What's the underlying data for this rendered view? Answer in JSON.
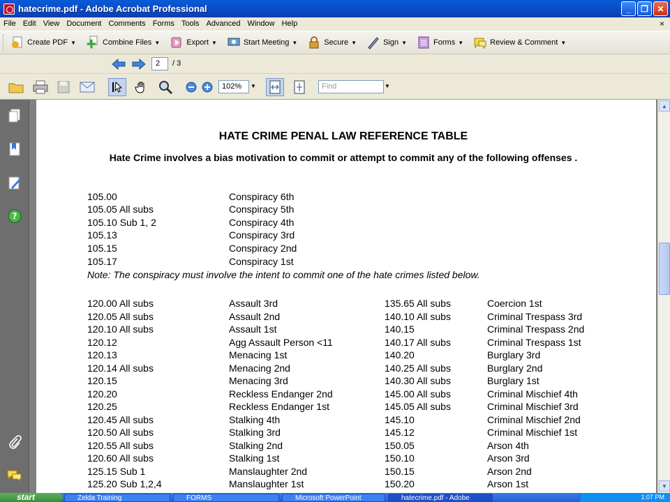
{
  "window": {
    "title": "hatecrime.pdf - Adobe Acrobat Professional",
    "minimize_label": "_",
    "restore_label": "❐",
    "close_label": "✕"
  },
  "menu": {
    "items": [
      "File",
      "Edit",
      "View",
      "Document",
      "Comments",
      "Forms",
      "Tools",
      "Advanced",
      "Window",
      "Help"
    ],
    "close_glyph": "×"
  },
  "tasks": [
    {
      "label": "Create PDF",
      "icon": "create-pdf-icon"
    },
    {
      "label": "Combine Files",
      "icon": "combine-files-icon"
    },
    {
      "label": "Export",
      "icon": "export-icon"
    },
    {
      "label": "Start Meeting",
      "icon": "meeting-icon"
    },
    {
      "label": "Secure",
      "icon": "lock-icon"
    },
    {
      "label": "Sign",
      "icon": "pen-icon"
    },
    {
      "label": "Forms",
      "icon": "forms-icon"
    },
    {
      "label": "Review & Comment",
      "icon": "review-icon"
    }
  ],
  "nav": {
    "current_page": "2",
    "total_pages": "/ 3"
  },
  "tools": {
    "zoom": "102%",
    "find_placeholder": "Find"
  },
  "document": {
    "title": "HATE CRIME PENAL LAW REFERENCE TABLE",
    "subtitle": "Hate Crime involves a bias motivation to commit or attempt to commit any of the following offenses .",
    "conspiracy": [
      {
        "code": "105.00",
        "offense": "Conspiracy 6th"
      },
      {
        "code": "105.05 All subs",
        "offense": "Conspiracy 5th"
      },
      {
        "code": "105.10 Sub 1, 2",
        "offense": "Conspiracy 4th"
      },
      {
        "code": "105.13",
        "offense": "Conspiracy 3rd"
      },
      {
        "code": "105.15",
        "offense": "Conspiracy 2nd"
      },
      {
        "code": "105.17",
        "offense": "Conspiracy 1st"
      }
    ],
    "note": "Note: The conspiracy must involve the intent to commit one of the hate crimes listed below.",
    "left_table": [
      {
        "code": "120.00 All subs",
        "offense": "Assault 3rd"
      },
      {
        "code": "120.05 All subs",
        "offense": "Assault 2nd"
      },
      {
        "code": "120.10 All subs",
        "offense": "Assault 1st"
      },
      {
        "code": "120.12",
        "offense": "Agg Assault Person <11"
      },
      {
        "code": "120.13",
        "offense": "Menacing 1st"
      },
      {
        "code": "120.14 All subs",
        "offense": "Menacing 2nd"
      },
      {
        "code": "120.15",
        "offense": "Menacing 3rd"
      },
      {
        "code": "120.20",
        "offense": "Reckless Endanger 2nd"
      },
      {
        "code": "120.25",
        "offense": "Reckless Endanger 1st"
      },
      {
        "code": "120.45 All subs",
        "offense": "Stalking 4th"
      },
      {
        "code": "120.50 All subs",
        "offense": "Stalking 3rd"
      },
      {
        "code": "120.55 All subs",
        "offense": "Stalking 2nd"
      },
      {
        "code": "120.60 All subs",
        "offense": "Stalking 1st"
      },
      {
        "code": "125.15  Sub 1",
        "offense": "Manslaughter 2nd"
      },
      {
        "code": "125.20 Sub 1,2,4",
        "offense": "Manslaughter 1st"
      }
    ],
    "right_table": [
      {
        "code": "135.65 All subs",
        "offense": "Coercion 1st"
      },
      {
        "code": "140.10 All subs",
        "offense": "Criminal Trespass 3rd"
      },
      {
        "code": "140.15",
        "offense": "Criminal Trespass 2nd"
      },
      {
        "code": "140.17 All subs",
        "offense": "Criminal Trespass 1st"
      },
      {
        "code": "140.20",
        "offense": "Burglary 3rd"
      },
      {
        "code": "140.25 All subs",
        "offense": "Burglary 2nd"
      },
      {
        "code": "140.30 All subs",
        "offense": "Burglary 1st"
      },
      {
        "code": "145.00 All subs",
        "offense": "Criminal Mischief 4th"
      },
      {
        "code": "145.05 All subs",
        "offense": "Criminal Mischief 3rd"
      },
      {
        "code": "145.10",
        "offense": "Criminal Mischief 2nd"
      },
      {
        "code": "145.12",
        "offense": "Criminal Mischief 1st"
      },
      {
        "code": "150.05",
        "offense": "Arson 4th"
      },
      {
        "code": "150.10",
        "offense": "Arson 3rd"
      },
      {
        "code": "150.15",
        "offense": "Arson 2nd"
      },
      {
        "code": "150.20",
        "offense": "Arson 1st"
      }
    ]
  },
  "taskbar": {
    "start_label": "start",
    "buttons": [
      "Zelda Training",
      "FORMS",
      "Microsoft PowerPoint",
      "hatecrime.pdf - Adobe"
    ],
    "clock": "1:07 PM"
  }
}
